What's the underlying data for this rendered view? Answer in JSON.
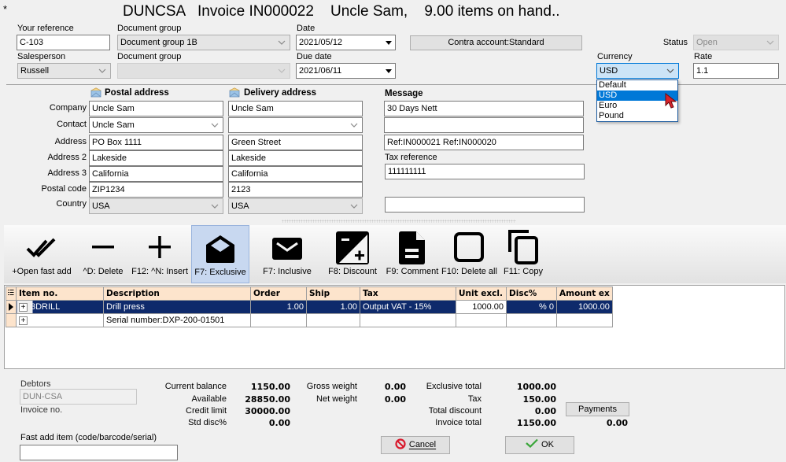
{
  "window": {
    "modified_marker": "*",
    "title": "DUNCSA   Invoice IN000022    Uncle Sam,    9.00 items on hand.."
  },
  "header": {
    "your_reference": {
      "label": "Your reference",
      "value": "C-103"
    },
    "document_group_1": {
      "label": "Document group",
      "value": "Document group 1B"
    },
    "date": {
      "label": "Date",
      "value": "2021/05/12"
    },
    "contra_button": "Contra account:Standard",
    "status": {
      "label": "Status",
      "value": "Open"
    },
    "salesperson": {
      "label": "Salesperson",
      "value": "Russell"
    },
    "document_group_2": {
      "label": "Document group",
      "value": ""
    },
    "due_date": {
      "label": "Due date",
      "value": "2021/06/11"
    },
    "currency": {
      "label": "Currency",
      "value": "USD",
      "options": [
        "Default",
        "USD",
        "Euro",
        "Pound"
      ],
      "highlighted": "USD"
    },
    "rate": {
      "label": "Rate",
      "value": "1.1"
    }
  },
  "postal": {
    "heading": "Postal address",
    "company": "Uncle Sam",
    "contact": "Uncle Sam",
    "address": "PO Box 1111",
    "address2": "Lakeside",
    "address3": "California",
    "postal_code": "ZIP1234",
    "country": "USA"
  },
  "delivery": {
    "heading": "Delivery address",
    "company": "Uncle Sam",
    "contact": "",
    "address": "Green Street",
    "address2": "Lakeside",
    "address3": "California",
    "postal_code": "2123",
    "country": "USA"
  },
  "address_labels": {
    "company": "Company",
    "contact": "Contact",
    "address": "Address",
    "address2": "Address 2",
    "address3": "Address 3",
    "postal_code": "Postal code",
    "country": "Country"
  },
  "message": {
    "heading": "Message",
    "line1": "30 Days Nett",
    "line2": "",
    "line3": "Ref:IN000021 Ref:IN000020",
    "tax_reference_label": "Tax reference",
    "tax_reference": "111111111",
    "extra": ""
  },
  "toolbar": [
    {
      "label": "+Open fast add",
      "icon": "double-check-icon"
    },
    {
      "label": "^D: Delete",
      "icon": "minus-icon"
    },
    {
      "label": "F12: ^N: Insert",
      "icon": "plus-icon"
    },
    {
      "label": "F7: Exclusive",
      "icon": "envelope-open-icon",
      "active": true
    },
    {
      "label": "F7: Inclusive",
      "icon": "envelope-icon"
    },
    {
      "label": "F8: Discount",
      "icon": "plus-minus-icon"
    },
    {
      "label": "F9: Comment",
      "icon": "document-icon"
    },
    {
      "label": "F10: Delete all",
      "icon": "square-icon"
    },
    {
      "label": "F11: Copy",
      "icon": "copy-icon"
    }
  ],
  "grid": {
    "columns": [
      "Item no.",
      "Description",
      "Order",
      "Ship",
      "Tax",
      "Unit excl.",
      "Disc%",
      "Amount ex"
    ],
    "rows": [
      {
        "item": "3DRILL",
        "description": "Drill press",
        "order": "1.00",
        "ship": "1.00",
        "tax": "Output VAT - 15%",
        "unit": "1000.00",
        "disc": "% 0",
        "amount": "1000.00",
        "selected": true
      },
      {
        "item": "",
        "description": "Serial number:DXP-200-01501",
        "order": "",
        "ship": "",
        "tax": "",
        "unit": "",
        "disc": "",
        "amount": "",
        "selected": false
      }
    ]
  },
  "footer": {
    "debtors_label": "Debtors",
    "debtors_value": "DUN-CSA",
    "invoice_no_label": "Invoice no.",
    "fast_add_label": "Fast add item (code/barcode/serial)",
    "fast_add_value": "",
    "current_balance": {
      "label": "Current balance",
      "value": "1150.00"
    },
    "available": {
      "label": "Available",
      "value": "28850.00"
    },
    "credit_limit": {
      "label": "Credit limit",
      "value": "30000.00"
    },
    "std_disc": {
      "label": "Std disc%",
      "value": "0.00"
    },
    "gross_weight": {
      "label": "Gross weight",
      "value": "0.00"
    },
    "net_weight": {
      "label": "Net weight",
      "value": "0.00"
    },
    "exclusive_total": {
      "label": "Exclusive total",
      "value": "1000.00"
    },
    "tax": {
      "label": "Tax",
      "value": "150.00"
    },
    "total_discount": {
      "label": "Total discount",
      "value": "0.00"
    },
    "invoice_total": {
      "label": "Invoice total",
      "value": "1150.00"
    },
    "payments_button": "Payments",
    "payments_value": "0.00",
    "cancel_button": "Cancel",
    "ok_button": "OK"
  },
  "colors": {
    "grid_header": "#fde4cc",
    "grid_selected": "#0e2a6b",
    "toolbar_active": "#c8d8f0",
    "dropdown_highlight": "#0078d7",
    "cancel_icon": "#d9192c",
    "ok_icon": "#3aa63a"
  }
}
